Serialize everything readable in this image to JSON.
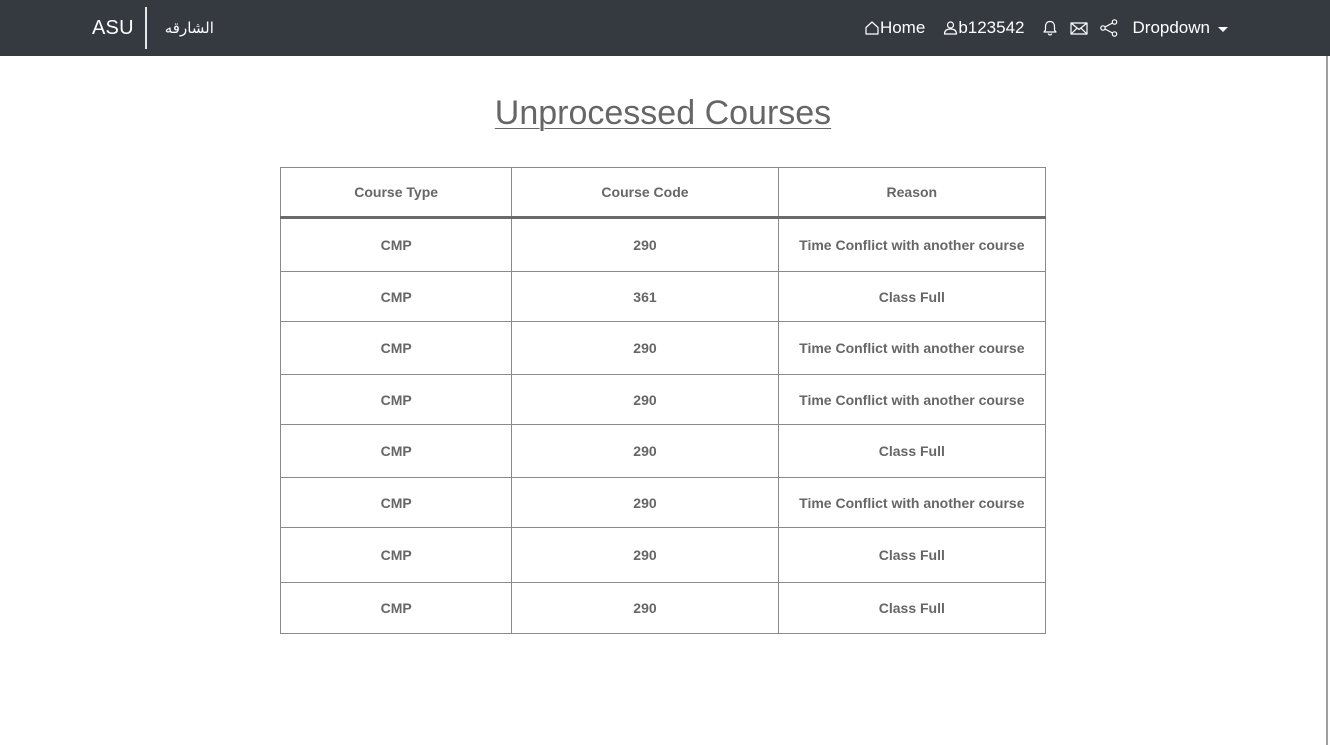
{
  "navbar": {
    "brand_en": "ASU",
    "brand_ar": "الشارقه",
    "home_label": "Home",
    "user_label": "b123542",
    "dropdown_label": "Dropdown",
    "background": "#343a40"
  },
  "page_title": "Unprocessed Courses",
  "table": {
    "headers": [
      "Course Type",
      "Course Code",
      "Reason"
    ],
    "rows": [
      {
        "type": "CMP",
        "code": "290",
        "reason": "Time Conflict with another course"
      },
      {
        "type": "CMP",
        "code": "361",
        "reason": "Class Full"
      },
      {
        "type": "CMP",
        "code": "290",
        "reason": "Time Conflict with another course"
      },
      {
        "type": "CMP",
        "code": "290",
        "reason": "Time Conflict with another course"
      },
      {
        "type": "CMP",
        "code": "290",
        "reason": "Class Full"
      },
      {
        "type": "CMP",
        "code": "290",
        "reason": "Time Conflict with another course"
      },
      {
        "type": "CMP",
        "code": "290",
        "reason": "Class Full"
      },
      {
        "type": "CMP",
        "code": "290",
        "reason": "Class Full"
      }
    ]
  },
  "icons": {
    "home": "home-icon",
    "user": "user-icon",
    "notifications": "bell-icon",
    "messages": "envelope-icon",
    "share": "share-icon",
    "dropdown": "caret-down-icon"
  }
}
